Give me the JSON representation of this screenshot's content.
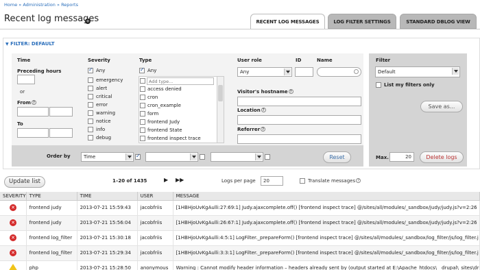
{
  "breadcrumb": {
    "home": "Home",
    "admin": "Administration",
    "reports": "Reports",
    "sep": "»"
  },
  "page_title": "Recent log messages",
  "tabs": [
    {
      "label": "RECENT LOG MESSAGES"
    },
    {
      "label": "LOG FILTER SETTINGS"
    },
    {
      "label": "STANDARD DBLOG VIEW"
    }
  ],
  "filter": {
    "legend": "FILTER: DEFAULT",
    "time": {
      "heading": "Time",
      "preceding_hours": "Preceding hours",
      "or": "or",
      "from": "From",
      "to": "To"
    },
    "severity": {
      "heading": "Severity",
      "items": [
        "Any",
        "emergency",
        "alert",
        "critical",
        "error",
        "warning",
        "notice",
        "info",
        "debug"
      ]
    },
    "type": {
      "heading": "Type",
      "any": "Any",
      "add_placeholder": "Add type...",
      "items": [
        "access denied",
        "cron",
        "cron_example",
        "form",
        "frontend Judy",
        "frontend State",
        "frontend inspect trace"
      ]
    },
    "user_role": {
      "heading": "User role",
      "value": "Any"
    },
    "id": {
      "heading": "ID"
    },
    "name": {
      "heading": "Name"
    },
    "visitor_hostname": "Visitor's hostname",
    "location": "Location",
    "referrer": "Referrer",
    "filter_panel": {
      "heading": "Filter",
      "value": "Default",
      "list_my_filters": "List my filters only",
      "save_as": "Save as..."
    },
    "order_by": {
      "label": "Order by",
      "first_value": "Time"
    },
    "reset": "Reset",
    "max_label": "Max.",
    "max_value": "20",
    "delete_logs": "Delete logs"
  },
  "toolbar": {
    "update_list": "Update list",
    "pager_text": "1–20 of 1435",
    "logs_per_page_label": "Logs per page",
    "logs_per_page_value": "20",
    "translate_messages": "Translate messages"
  },
  "table": {
    "headers": [
      "SEVERITY",
      "TYPE",
      "TIME",
      "USER",
      "MESSAGE"
    ],
    "rows": [
      {
        "severity": "error",
        "type": "frontend judy",
        "time": "2013-07-21 15:59:43",
        "user": "jacobfriis",
        "message": "[1HBHjoUvKgAulli:27:69:1] Judy.ajaxcomplete.off() [frontend inspect trace] @/sites/all/modules/_sandbox/judy/judy.js?v=2:26"
      },
      {
        "severity": "error",
        "type": "frontend judy",
        "time": "2013-07-21 15:56:04",
        "user": "jacobfriis",
        "message": "[1HBHjoUvKgAulli:26:67:1] Judy.ajaxcomplete.off() [frontend inspect trace] @/sites/all/modules/_sandbox/judy/judy.js?v=2:26"
      },
      {
        "severity": "error",
        "type": "frontend log_filter",
        "time": "2013-07-21 15:30:18",
        "user": "jacobfriis",
        "message": "[1HBHjoUvKgAulli:4:5:1] LogFilter._prepareForm() [frontend inspect trace] @/sites/all/modules/_sandbox/log_filter/js/log_filter.j"
      },
      {
        "severity": "error",
        "type": "frontend log_filter",
        "time": "2013-07-21 15:29:34",
        "user": "jacobfriis",
        "message": "[1HBHjoUvKgAulli:3:3:1] LogFilter._prepareForm() [frontend inspect trace] @/sites/all/modules/_sandbox/log_filter/js/log_filter.j"
      },
      {
        "severity": "warning",
        "type": "php",
        "time": "2013-07-21 15:28:50",
        "user": "anonymous",
        "message": "Warning : Cannot modify header information – headers already sent by (output started at E:\\Apache_htdocs\\__drupal\\_sites\\dr"
      }
    ]
  },
  "colors": {
    "link": "#2a6ebb",
    "error": "#d42a2a",
    "warning": "#f0c419",
    "panel_grey": "#d4d4d4"
  },
  "icons": [
    "info-icon",
    "triangle-down-icon",
    "help-icon",
    "error-icon",
    "warning-icon",
    "play-icon",
    "fast-forward-icon"
  ]
}
